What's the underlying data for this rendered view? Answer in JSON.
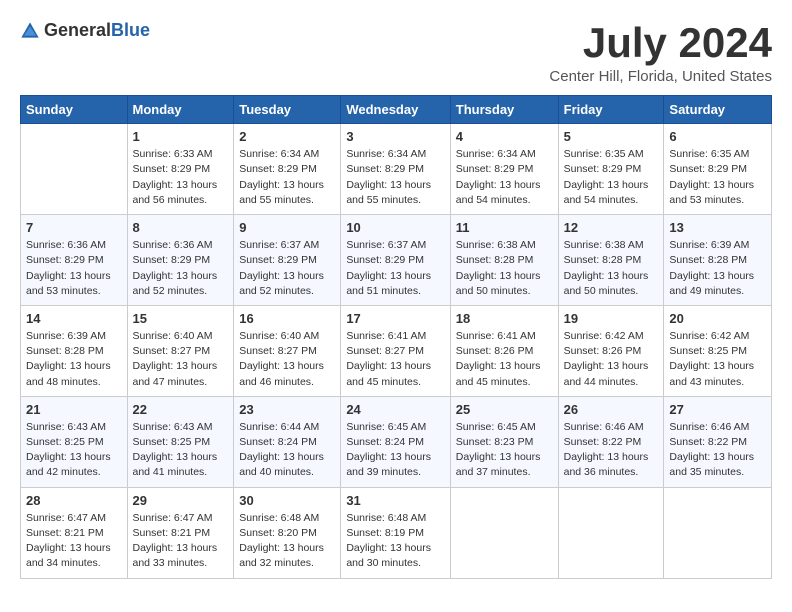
{
  "header": {
    "logo_general": "General",
    "logo_blue": "Blue",
    "title": "July 2024",
    "location": "Center Hill, Florida, United States"
  },
  "columns": [
    "Sunday",
    "Monday",
    "Tuesday",
    "Wednesday",
    "Thursday",
    "Friday",
    "Saturday"
  ],
  "weeks": [
    [
      {
        "day": "",
        "text": ""
      },
      {
        "day": "1",
        "text": "Sunrise: 6:33 AM\nSunset: 8:29 PM\nDaylight: 13 hours\nand 56 minutes."
      },
      {
        "day": "2",
        "text": "Sunrise: 6:34 AM\nSunset: 8:29 PM\nDaylight: 13 hours\nand 55 minutes."
      },
      {
        "day": "3",
        "text": "Sunrise: 6:34 AM\nSunset: 8:29 PM\nDaylight: 13 hours\nand 55 minutes."
      },
      {
        "day": "4",
        "text": "Sunrise: 6:34 AM\nSunset: 8:29 PM\nDaylight: 13 hours\nand 54 minutes."
      },
      {
        "day": "5",
        "text": "Sunrise: 6:35 AM\nSunset: 8:29 PM\nDaylight: 13 hours\nand 54 minutes."
      },
      {
        "day": "6",
        "text": "Sunrise: 6:35 AM\nSunset: 8:29 PM\nDaylight: 13 hours\nand 53 minutes."
      }
    ],
    [
      {
        "day": "7",
        "text": "Sunrise: 6:36 AM\nSunset: 8:29 PM\nDaylight: 13 hours\nand 53 minutes."
      },
      {
        "day": "8",
        "text": "Sunrise: 6:36 AM\nSunset: 8:29 PM\nDaylight: 13 hours\nand 52 minutes."
      },
      {
        "day": "9",
        "text": "Sunrise: 6:37 AM\nSunset: 8:29 PM\nDaylight: 13 hours\nand 52 minutes."
      },
      {
        "day": "10",
        "text": "Sunrise: 6:37 AM\nSunset: 8:29 PM\nDaylight: 13 hours\nand 51 minutes."
      },
      {
        "day": "11",
        "text": "Sunrise: 6:38 AM\nSunset: 8:28 PM\nDaylight: 13 hours\nand 50 minutes."
      },
      {
        "day": "12",
        "text": "Sunrise: 6:38 AM\nSunset: 8:28 PM\nDaylight: 13 hours\nand 50 minutes."
      },
      {
        "day": "13",
        "text": "Sunrise: 6:39 AM\nSunset: 8:28 PM\nDaylight: 13 hours\nand 49 minutes."
      }
    ],
    [
      {
        "day": "14",
        "text": "Sunrise: 6:39 AM\nSunset: 8:28 PM\nDaylight: 13 hours\nand 48 minutes."
      },
      {
        "day": "15",
        "text": "Sunrise: 6:40 AM\nSunset: 8:27 PM\nDaylight: 13 hours\nand 47 minutes."
      },
      {
        "day": "16",
        "text": "Sunrise: 6:40 AM\nSunset: 8:27 PM\nDaylight: 13 hours\nand 46 minutes."
      },
      {
        "day": "17",
        "text": "Sunrise: 6:41 AM\nSunset: 8:27 PM\nDaylight: 13 hours\nand 45 minutes."
      },
      {
        "day": "18",
        "text": "Sunrise: 6:41 AM\nSunset: 8:26 PM\nDaylight: 13 hours\nand 45 minutes."
      },
      {
        "day": "19",
        "text": "Sunrise: 6:42 AM\nSunset: 8:26 PM\nDaylight: 13 hours\nand 44 minutes."
      },
      {
        "day": "20",
        "text": "Sunrise: 6:42 AM\nSunset: 8:25 PM\nDaylight: 13 hours\nand 43 minutes."
      }
    ],
    [
      {
        "day": "21",
        "text": "Sunrise: 6:43 AM\nSunset: 8:25 PM\nDaylight: 13 hours\nand 42 minutes."
      },
      {
        "day": "22",
        "text": "Sunrise: 6:43 AM\nSunset: 8:25 PM\nDaylight: 13 hours\nand 41 minutes."
      },
      {
        "day": "23",
        "text": "Sunrise: 6:44 AM\nSunset: 8:24 PM\nDaylight: 13 hours\nand 40 minutes."
      },
      {
        "day": "24",
        "text": "Sunrise: 6:45 AM\nSunset: 8:24 PM\nDaylight: 13 hours\nand 39 minutes."
      },
      {
        "day": "25",
        "text": "Sunrise: 6:45 AM\nSunset: 8:23 PM\nDaylight: 13 hours\nand 37 minutes."
      },
      {
        "day": "26",
        "text": "Sunrise: 6:46 AM\nSunset: 8:22 PM\nDaylight: 13 hours\nand 36 minutes."
      },
      {
        "day": "27",
        "text": "Sunrise: 6:46 AM\nSunset: 8:22 PM\nDaylight: 13 hours\nand 35 minutes."
      }
    ],
    [
      {
        "day": "28",
        "text": "Sunrise: 6:47 AM\nSunset: 8:21 PM\nDaylight: 13 hours\nand 34 minutes."
      },
      {
        "day": "29",
        "text": "Sunrise: 6:47 AM\nSunset: 8:21 PM\nDaylight: 13 hours\nand 33 minutes."
      },
      {
        "day": "30",
        "text": "Sunrise: 6:48 AM\nSunset: 8:20 PM\nDaylight: 13 hours\nand 32 minutes."
      },
      {
        "day": "31",
        "text": "Sunrise: 6:48 AM\nSunset: 8:19 PM\nDaylight: 13 hours\nand 30 minutes."
      },
      {
        "day": "",
        "text": ""
      },
      {
        "day": "",
        "text": ""
      },
      {
        "day": "",
        "text": ""
      }
    ]
  ]
}
